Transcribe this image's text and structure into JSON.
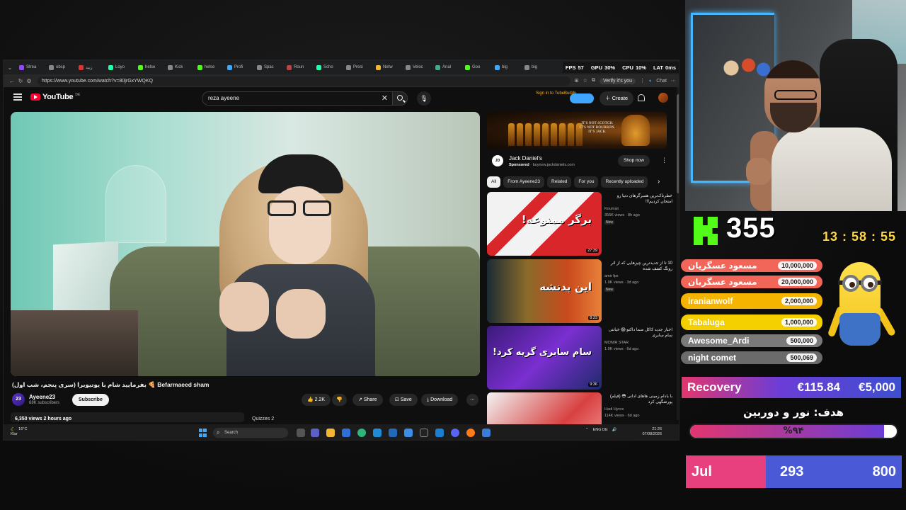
{
  "browser": {
    "tabs": [
      "Strea",
      "obsp",
      "زبید",
      "Loyo",
      "helse",
      "Kick",
      "helse",
      "Profi",
      "Spac",
      "Roun",
      "Scho",
      "Presi",
      "Netw",
      "Veloc",
      "Anal",
      "Goo",
      "big",
      "big"
    ],
    "url": "https://www.youtube.com/watch?v=80jrGxYWQKQ",
    "verify": "Verify it's you",
    "chat": "Chat",
    "stats": [
      {
        "label": "FPS",
        "value": "57"
      },
      {
        "label": "GPU",
        "value": "30%"
      },
      {
        "label": "CPU",
        "value": "10%"
      },
      {
        "label": "LAT",
        "value": "0ms"
      }
    ]
  },
  "youtube": {
    "logo": "YouTube",
    "logo_country": "DE",
    "search_query": "reza ayeene",
    "tubebuddy": "Sign in to TubeBuddy",
    "create": "Create",
    "video": {
      "title": "بفرمایید شام با یوتیوبرا (سری پنجم، شب اول) 🍕 Befarmaeed sham",
      "channel": "Ayeene23",
      "channel_avatar_text": "23",
      "subscribers": "68K subscribers",
      "subscribe": "Subscribe",
      "likes": "2.2K",
      "share": "Share",
      "save": "Save",
      "download": "Download",
      "views": "6,350 views  2 hours ago",
      "quizzes": "Quizzes 2"
    },
    "ad": {
      "slogan": [
        "IT'S NOT SCOTCH.",
        "IT'S NOT BOURBON.",
        "IT'S JACK."
      ],
      "name": "Jack Daniel's",
      "sponsored": "Sponsored",
      "domain": "buynow.jackdaniels.com",
      "shop_now": "Shop now"
    },
    "chips": [
      "All",
      "From Ayeene23",
      "Related",
      "For you",
      "Recently uploaded"
    ],
    "recommendations": [
      {
        "title": "خطرناک‌ترین همبرگرهای دنیا رو امتحان کردیم!!!",
        "channel": "Kouman",
        "meta": "356K views · 8h ago",
        "badge": "New",
        "duration": "27:39",
        "thumb_text": "برگر ممنوعه!"
      },
      {
        "title": "10 تا از جدیدترین چیزهایی که از اثر رونگ کشف شده",
        "channel": "amir fps",
        "meta": "1.9K views · 3d ago",
        "badge": "New",
        "duration": "8:23",
        "thumb_text": "این بدنشه"
      },
      {
        "title": "اخبار جدید کاکل ضما داکتو 😱 خیانتی سام سابری",
        "channel": "MONIR STAR",
        "meta": "1.9K views · 6d ago",
        "badge": "",
        "duration": "9:36",
        "thumb_text": "سام سابری گریه کرد!"
      },
      {
        "title": "با بادام زمینی هاهای ادانی 😳 (فیلم) پورشگهی کرد",
        "channel": "Hadi Hyrox",
        "meta": "114K views · 6d ago",
        "badge": "",
        "duration": "",
        "thumb_text": ""
      }
    ]
  },
  "taskbar": {
    "weather_temp": "16°C",
    "weather_desc": "Klar",
    "search": "Search",
    "lang": "ENG DE",
    "time": "21:26",
    "date": "07/08/2026"
  },
  "overlay": {
    "kick_count": "355",
    "timer": "13 : 58 : 55",
    "donors": [
      {
        "name": "مسعود عسگریان",
        "amount": "10,000,000",
        "color": "#f2665a"
      },
      {
        "name": "مسعود عسگریان",
        "amount": "20,000,000",
        "color": "#f2665a"
      },
      {
        "name": "iranianwolf",
        "amount": "2,000,000",
        "color": "#f5b400"
      },
      {
        "name": "Tabaluga",
        "amount": "1,000,000",
        "color": "#f5d000"
      },
      {
        "name": "Awesome_Ardi",
        "amount": "500,000",
        "color": "#7a7a7a"
      },
      {
        "name": "night comet",
        "amount": "500,069",
        "color": "#6b6b6b"
      }
    ],
    "recovery": {
      "label": "Recovery",
      "current": "€115.84",
      "target": "€5,000"
    },
    "goal": {
      "label": "هدف: نور و دوربین",
      "percent_text": "%۹۴",
      "fraction": 0.94
    },
    "subs": {
      "month": "Jul",
      "current": "293",
      "target": "800"
    }
  }
}
